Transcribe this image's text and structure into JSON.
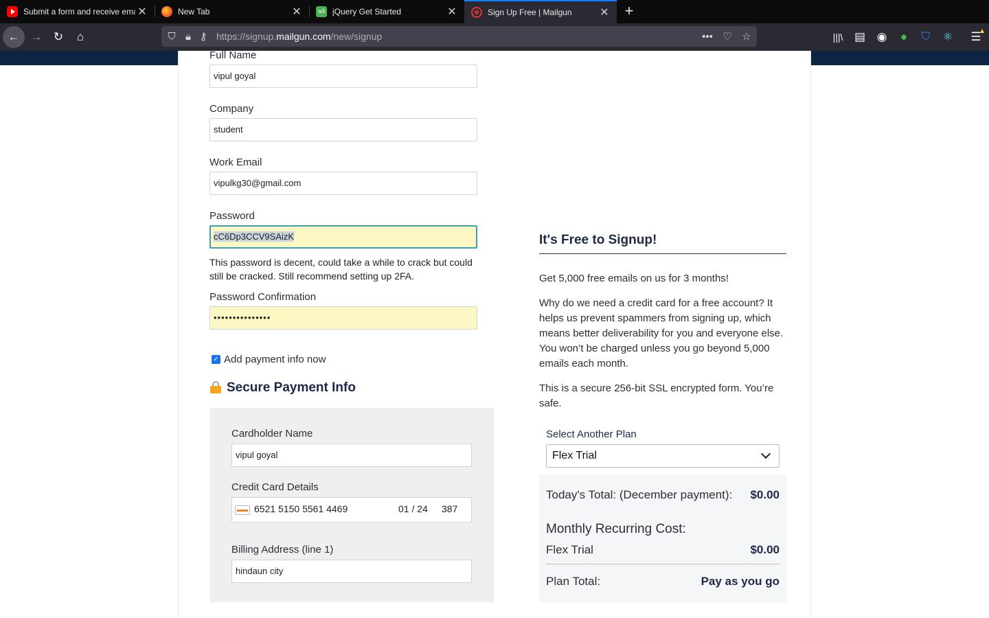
{
  "browser": {
    "tabs": [
      {
        "title": "Submit a form and receive ema",
        "active": false,
        "favicon": "youtube-icon"
      },
      {
        "title": "New Tab",
        "active": false,
        "favicon": "firefox-icon"
      },
      {
        "title": "jQuery Get Started",
        "active": false,
        "favicon": "w3schools-icon"
      },
      {
        "title": "Sign Up Free | Mailgun",
        "active": true,
        "favicon": "mailgun-icon"
      }
    ],
    "url_prefix": "https://signup.",
    "url_domain": "mailgun.com",
    "url_path": "/new/signup"
  },
  "form": {
    "full_name": {
      "label": "Full Name",
      "value": "vipul goyal"
    },
    "company": {
      "label": "Company",
      "value": "student"
    },
    "work_email": {
      "label": "Work Email",
      "value": "vipulkg30@gmail.com"
    },
    "password": {
      "label": "Password",
      "value": "cC6Dp3CCV9SAizK"
    },
    "password_hint": "This password is decent, could take a while to crack but could still be cracked. Still recommend setting up 2FA.",
    "password_confirmation": {
      "label": "Password Confirmation",
      "value": "•••••••••••••••"
    },
    "add_payment": {
      "label": "Add payment info now",
      "checked": true
    }
  },
  "payment": {
    "title": "Secure Payment Info",
    "cardholder": {
      "label": "Cardholder Name",
      "value": "vipul goyal"
    },
    "card": {
      "label": "Credit Card Details",
      "number": "6521 5150 5561 4469",
      "expiry": "01 / 24",
      "cvc": "387"
    },
    "billing": {
      "label": "Billing Address (line 1)",
      "value": "hindaun city"
    }
  },
  "sidebar": {
    "heading": "It's Free to Signup!",
    "p1": "Get 5,000 free emails on us for 3 months!",
    "p2": "Why do we need a credit card for a free account? It helps us prevent spammers from signing up, which means better deliverability for you and everyone else. You won’t be charged unless you go beyond 5,000 emails each month.",
    "p3": "This is a secure 256-bit SSL encrypted form. You’re safe.",
    "plan_label": "Select Another Plan",
    "plan_value": "Flex Trial"
  },
  "totals": {
    "today_label": "Today's Total: (December payment):",
    "today_value": "$0.00",
    "monthly_heading": "Monthly Recurring Cost:",
    "plan_name": "Flex Trial",
    "plan_cost": "$0.00",
    "plan_total_label": "Plan Total:",
    "plan_total_value": "Pay as you go"
  }
}
